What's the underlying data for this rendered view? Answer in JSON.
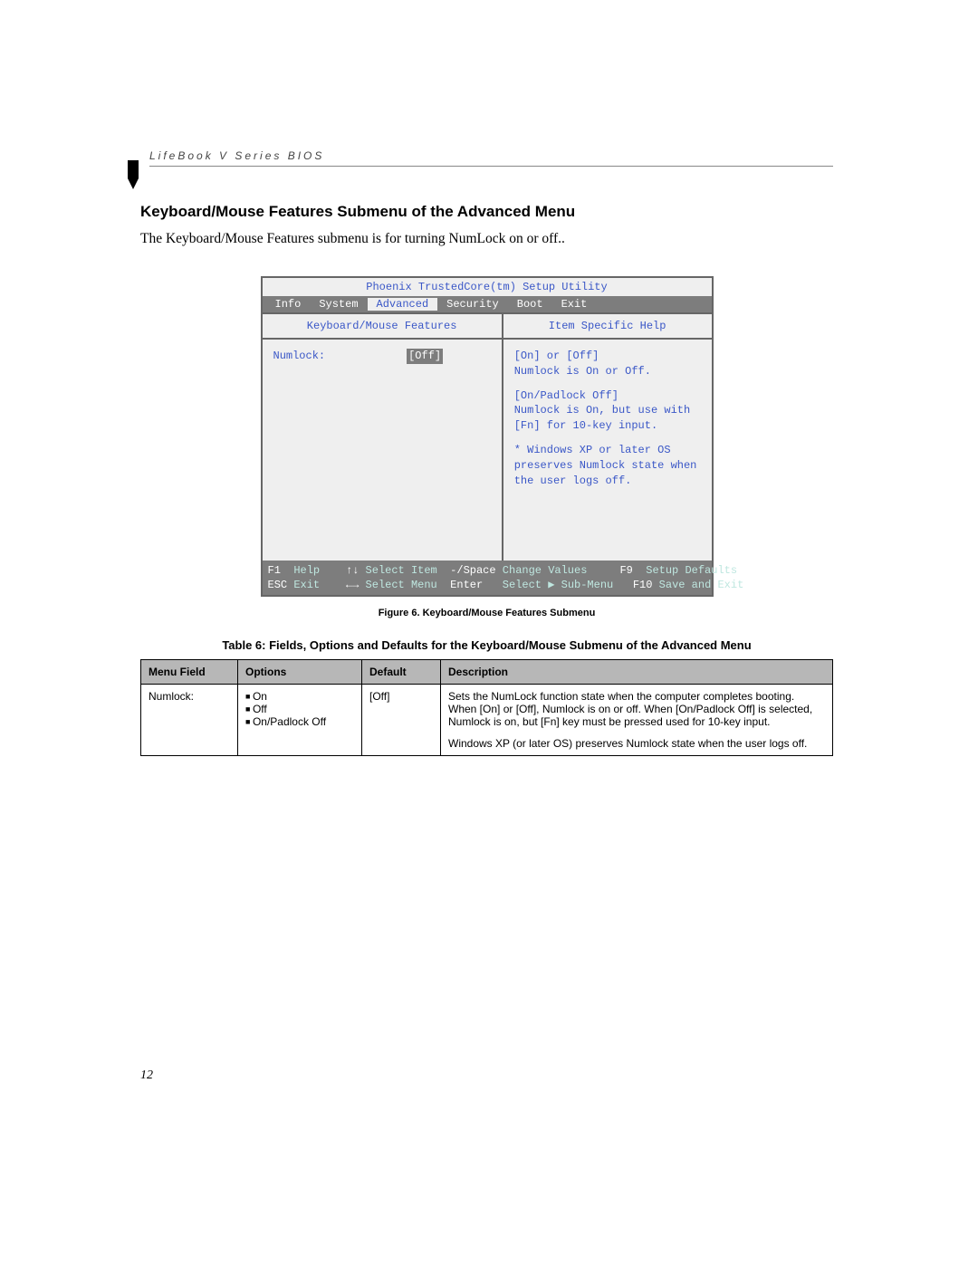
{
  "runningHead": "LifeBook V Series BIOS",
  "sectionTitle": "Keyboard/Mouse Features Submenu of the Advanced Menu",
  "bodyText": "The Keyboard/Mouse Features submenu is for turning NumLock on or off..",
  "bios": {
    "utilityTitle": "Phoenix TrustedCore(tm) Setup Utility",
    "menu": {
      "items": [
        "Info",
        "System",
        "Advanced",
        "Security",
        "Boot",
        "Exit"
      ],
      "activeIndex": 2
    },
    "leftPanelTitle": "Keyboard/Mouse Features",
    "rightPanelTitle": "Item Specific Help",
    "fieldLabel": "Numlock:",
    "fieldValue": "[Off]",
    "help": {
      "line1": "[On] or [Off]",
      "line2": "Numlock is On or Off.",
      "line3": "[On/Padlock Off]",
      "line4": "Numlock is On, but use with [Fn] for 10-key input.",
      "line5": "* Windows XP or later OS preserves Numlock state when the user logs off."
    },
    "footer": {
      "f1": "F1",
      "help": "Help",
      "ud": "↑↓",
      "selectItem": "Select Item",
      "minusSpace": "-/Space",
      "changeValues": "Change Values",
      "f9": "F9",
      "setupDefaults": "Setup Defaults",
      "esc": "ESC",
      "exit": "Exit",
      "lr": "←→",
      "selectMenu": "Select Menu",
      "enter": "Enter",
      "selectSub": "Select ▶ Sub-Menu",
      "f10": "F10",
      "saveExit": "Save and Exit"
    }
  },
  "figureCaption": "Figure 6.  Keyboard/Mouse Features Submenu",
  "tableCaption": "Table 6: Fields, Options and Defaults for the Keyboard/Mouse Submenu of the Advanced Menu",
  "table": {
    "headers": {
      "menuField": "Menu Field",
      "options": "Options",
      "default": "Default",
      "description": "Description"
    },
    "row": {
      "menuField": "Numlock:",
      "options": {
        "o1": "On",
        "o2": "Off",
        "o3": "On/Padlock Off"
      },
      "default": "[Off]",
      "descP1": "Sets the NumLock function state when the computer completes booting. When [On] or [Off], Numlock is on or off. When [On/Padlock Off] is selected, Numlock is on, but [Fn] key must be pressed used for 10-key input.",
      "descP2": "Windows XP (or later OS) preserves Numlock state when the user logs off."
    }
  },
  "pageNumber": "12"
}
